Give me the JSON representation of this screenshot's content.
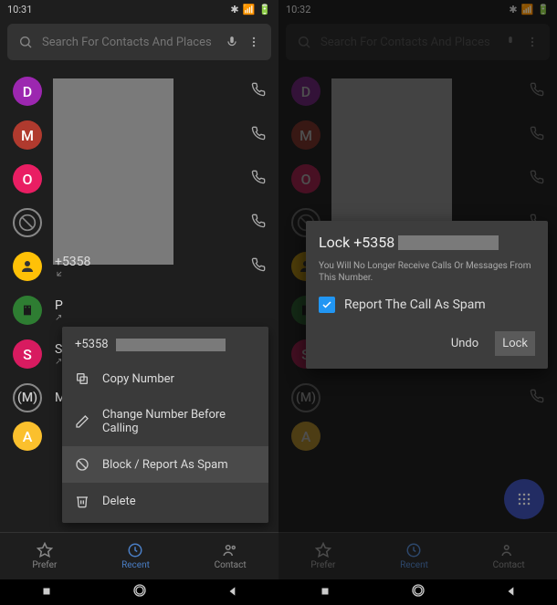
{
  "left": {
    "time": "10:31",
    "search_placeholder": "Search For Contacts And Places",
    "number_display": "+5358",
    "rows": {
      "p_initial": "P",
      "s_initial": "S",
      "m_initial": "M",
      "a_initial": "A"
    },
    "context": {
      "title": "+5358",
      "copy": "Copy Number",
      "edit": "Change Number Before Calling",
      "block": "Block / Report As Spam",
      "delete": "Delete"
    },
    "nav": {
      "prefer": "Prefer",
      "recent": "Recent",
      "contact": "Contact"
    }
  },
  "right": {
    "time": "10:32",
    "search_placeholder": "Search For Contacts And Places",
    "dialog": {
      "title": "Lock +5358",
      "subtitle": "You Will No Longer Receive Calls Or Messages From This Number.",
      "checkbox_label": "Report The Call As Spam",
      "undo": "Undo",
      "lock": "Lock"
    },
    "nav": {
      "prefer": "Prefer",
      "recent": "Recent",
      "contact": "Contact"
    }
  },
  "avatars": {
    "d": "D",
    "m": "M",
    "o": "O",
    "s": "S",
    "m2": "(M)",
    "a": "A"
  }
}
